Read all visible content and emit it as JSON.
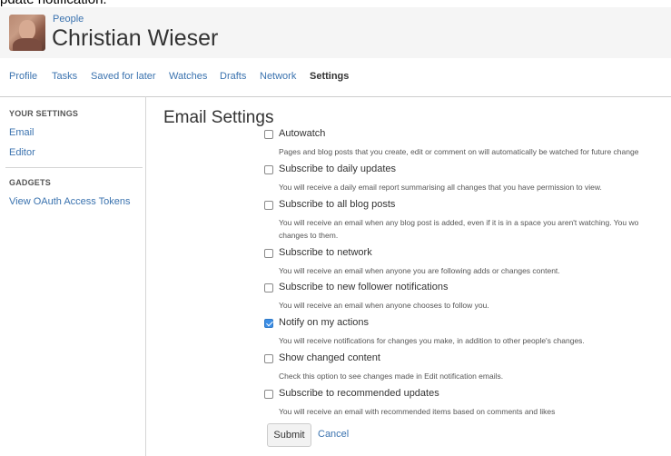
{
  "top_clip_text": "pdate notification.",
  "header": {
    "breadcrumb": "People",
    "user_name": "Christian Wieser"
  },
  "nav": {
    "tabs": [
      {
        "label": "Profile"
      },
      {
        "label": "Tasks"
      },
      {
        "label": "Saved for later"
      },
      {
        "label": "Watches"
      },
      {
        "label": "Drafts"
      },
      {
        "label": "Network"
      },
      {
        "label": "Settings",
        "active": true
      }
    ]
  },
  "sidebar": {
    "your_settings_heading": "YOUR SETTINGS",
    "email_link": "Email",
    "editor_link": "Editor",
    "gadgets_heading": "GADGETS",
    "oauth_link": "View OAuth Access Tokens"
  },
  "main": {
    "title": "Email Settings",
    "options": [
      {
        "label": "Autowatch",
        "checked": false,
        "desc": "Pages and blog posts that you create, edit or comment on will automatically be watched for future change"
      },
      {
        "label": "Subscribe to daily updates",
        "checked": false,
        "desc": "You will receive a daily email report summarising all changes that you have permission to view."
      },
      {
        "label": "Subscribe to all blog posts",
        "checked": false,
        "desc": "You will receive an email when any blog post is added, even if it is in a space you aren't watching. You wo",
        "desc2": "changes to them."
      },
      {
        "label": "Subscribe to network",
        "checked": false,
        "desc": "You will receive an email when anyone you are following adds or changes content."
      },
      {
        "label": "Subscribe to new follower notifications",
        "checked": false,
        "desc": "You will receive an email when anyone chooses to follow you."
      },
      {
        "label": "Notify on my actions",
        "checked": true,
        "desc": "You will receive notifications for changes you make, in addition to other people's changes."
      },
      {
        "label": "Show changed content",
        "checked": false,
        "desc": "Check this option to see changes made in Edit notification emails."
      },
      {
        "label": "Subscribe to recommended updates",
        "checked": false,
        "desc": "You will receive an email with recommended items based on comments and likes"
      }
    ],
    "submit_label": "Submit",
    "cancel_label": "Cancel"
  },
  "colors": {
    "link": "#3b73af",
    "checkbox_checked": "#3b8ee6",
    "header_bg": "#f5f5f5"
  }
}
